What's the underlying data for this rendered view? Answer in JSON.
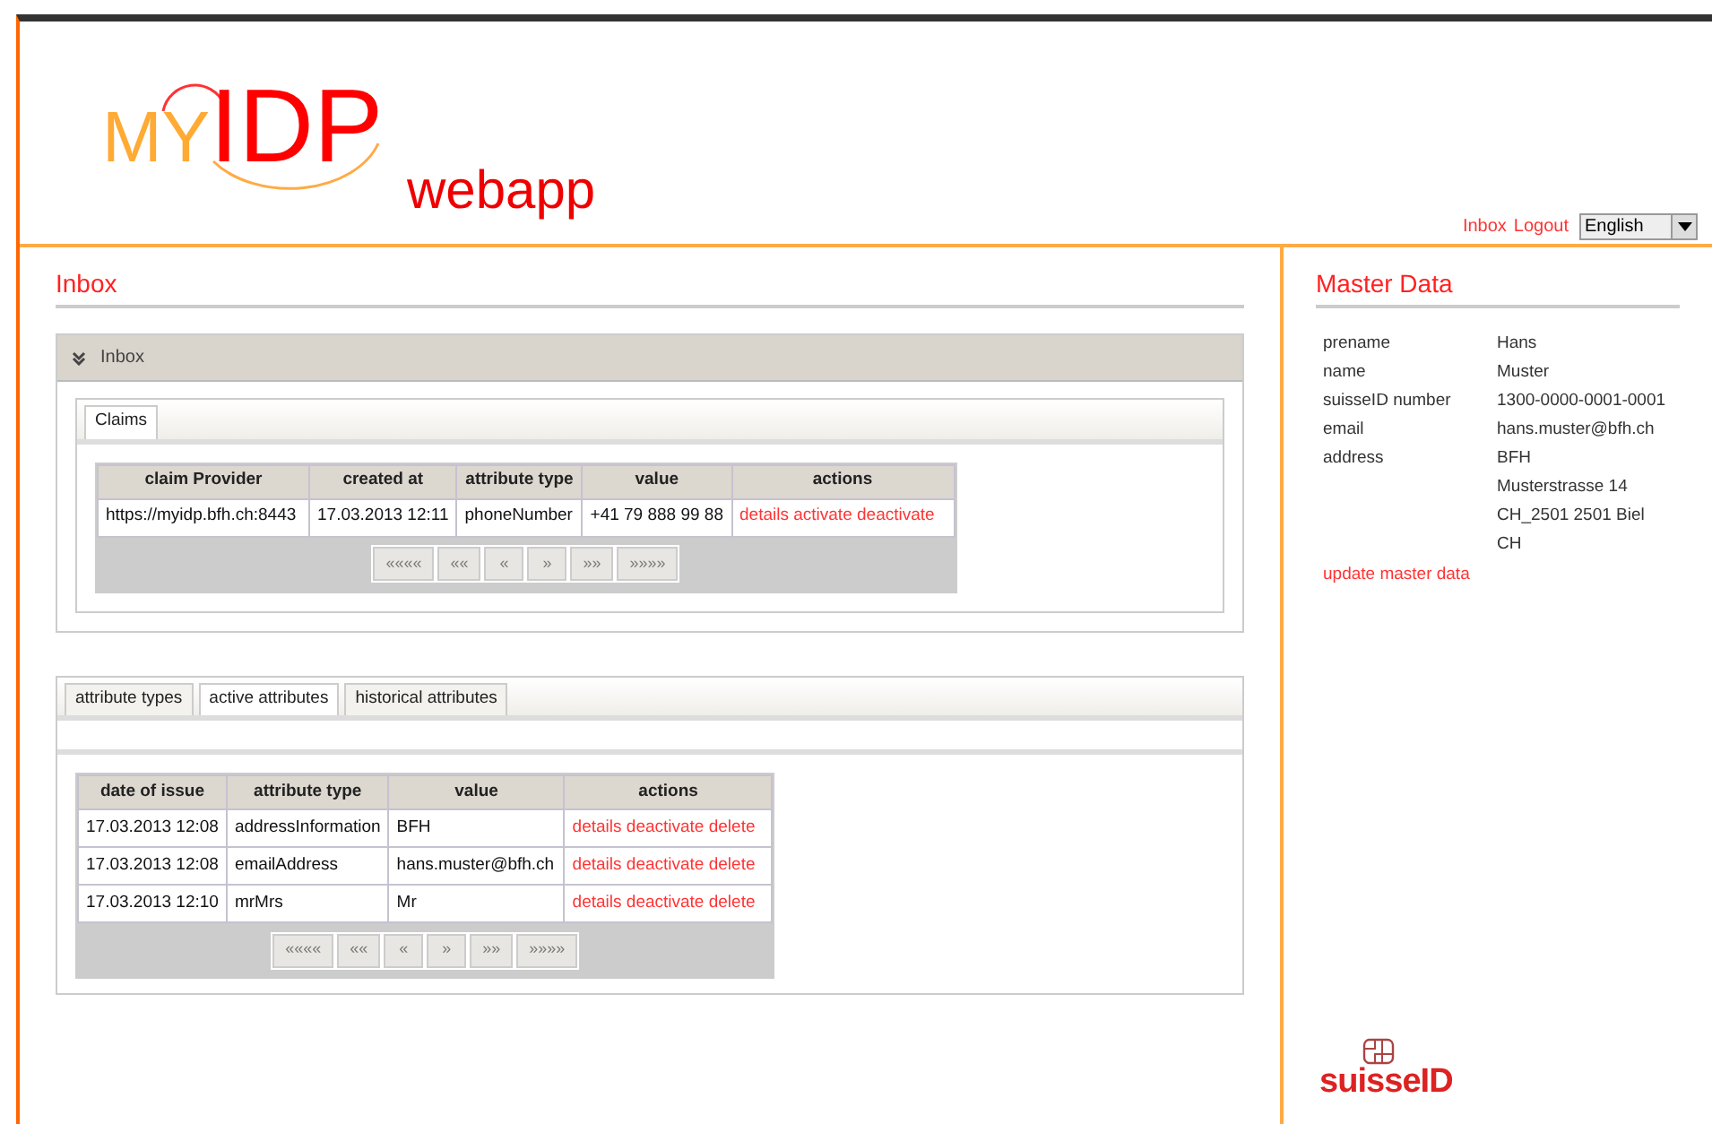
{
  "logo": {
    "prefix": "MY",
    "main": "IDP",
    "suffix": "webapp"
  },
  "top_links": [
    "Inbox",
    "Logout"
  ],
  "language": {
    "value": "English"
  },
  "inbox": {
    "title": "Inbox",
    "panel_title": "Inbox",
    "tabs": [
      {
        "label": "Claims",
        "selected": true
      }
    ],
    "table": {
      "columns": [
        "claim Provider",
        "created at",
        "attribute type",
        "value",
        "actions"
      ],
      "rows": [
        {
          "cells": [
            "https://myidp.bfh.ch:8443",
            "17.03.2013 12:11",
            "phoneNumber",
            "+41 79 888 99 88"
          ],
          "actions": [
            "details",
            "activate",
            "deactivate"
          ]
        }
      ]
    },
    "pager": [
      "««««",
      "««",
      "«",
      "»",
      "»»",
      "»»»»"
    ]
  },
  "attributes": {
    "tabs": [
      {
        "label": "attribute types",
        "selected": false
      },
      {
        "label": "active attributes",
        "selected": true
      },
      {
        "label": "historical attributes",
        "selected": false
      }
    ],
    "table": {
      "columns": [
        "date of issue",
        "attribute type",
        "value",
        "actions"
      ],
      "rows": [
        {
          "cells": [
            "17.03.2013 12:08",
            "addressInformation",
            "BFH"
          ],
          "actions": [
            "details",
            "deactivate",
            "delete"
          ]
        },
        {
          "cells": [
            "17.03.2013 12:08",
            "emailAddress",
            "hans.muster@bfh.ch"
          ],
          "actions": [
            "details",
            "deactivate",
            "delete"
          ]
        },
        {
          "cells": [
            "17.03.2013 12:10",
            "mrMrs",
            "Mr"
          ],
          "actions": [
            "details",
            "deactivate",
            "delete"
          ]
        }
      ]
    },
    "pager": [
      "««««",
      "««",
      "«",
      "»",
      "»»",
      "»»»»"
    ]
  },
  "master_data": {
    "title": "Master Data",
    "fields": [
      {
        "label": "prename",
        "lines": [
          "Hans"
        ]
      },
      {
        "label": "name",
        "lines": [
          "Muster"
        ]
      },
      {
        "label": "suisseID number",
        "lines": [
          "1300-0000-0001-0001"
        ]
      },
      {
        "label": "email",
        "lines": [
          "hans.muster@bfh.ch"
        ]
      },
      {
        "label": "address",
        "lines": [
          "BFH",
          "Musterstrasse 14",
          "CH_2501 2501 Biel",
          "CH"
        ]
      }
    ],
    "update_link": "update master data"
  },
  "footer_logo": {
    "text": "suisseID"
  }
}
